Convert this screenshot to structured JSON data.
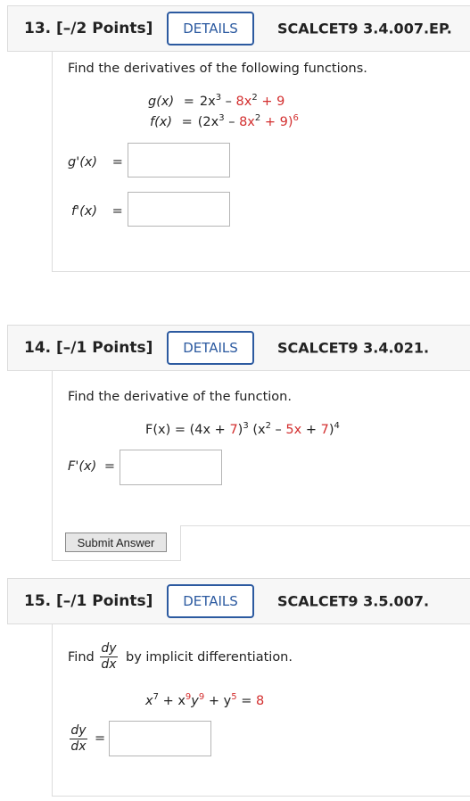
{
  "q13": {
    "number": "13.  [–/2 Points]",
    "details": "DETAILS",
    "code": "SCALCET9 3.4.007.EP.",
    "prompt": "Find the derivatives of the following functions.",
    "g_lhs": "g(x)",
    "g_terms": [
      "2x",
      "3",
      " – ",
      "8x",
      "2",
      " + 9"
    ],
    "f_lhs": "f(x)",
    "f_terms": [
      "(2x",
      "3",
      " – ",
      "8x",
      "2",
      " + 9)",
      "6"
    ],
    "gprime_label": "g'(x)",
    "fprime_label": "f'(x)",
    "eq": "="
  },
  "q14": {
    "number": "14.  [–/1 Points]",
    "details": "DETAILS",
    "code": "SCALCET9 3.4.021.",
    "prompt": "Find the derivative of the function.",
    "F_lhs": "F(x) = (4x + ",
    "F_seven": "7",
    "F_mid": ")",
    "F_exp3": "3",
    "F_paren": " (x",
    "F_exp2": "2",
    "F_minus": " – ",
    "F_five": "5x",
    "F_plus": " + ",
    "F_seven2": "7",
    "F_close": ")",
    "F_exp4": "4",
    "Fprime_label": "F'(x)",
    "eq": "=",
    "submit": "Submit Answer"
  },
  "q15": {
    "number": "15.  [–/1 Points]",
    "details": "DETAILS",
    "code": "SCALCET9 3.5.007.",
    "find": "Find",
    "frac_num": "dy",
    "frac_den": "dx",
    "suffix": "by implicit differentiation.",
    "eq_x": "x",
    "eq_x_exp": "7",
    "eq_plus1": " + x",
    "eq_x9": "9",
    "eq_y": "y",
    "eq_y9": "9",
    "eq_plus2": " + y",
    "eq_y5": "5",
    "eq_eq": " = ",
    "eq_rhs": "8",
    "eq": "="
  }
}
